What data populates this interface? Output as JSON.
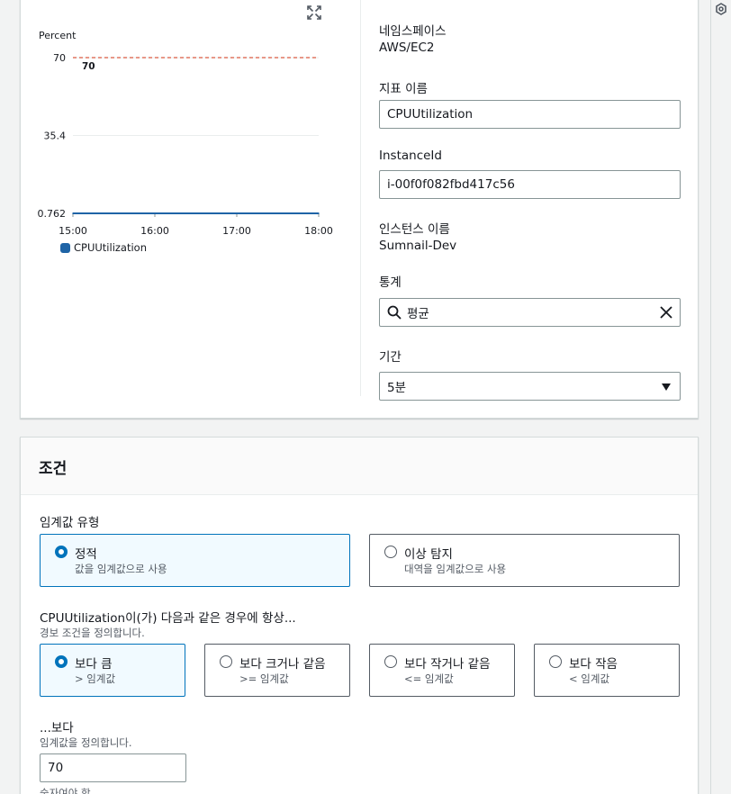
{
  "chart_data": {
    "type": "line",
    "ylabel": "Percent",
    "yticks": [
      "70",
      "35.4",
      "0.762"
    ],
    "ylim": [
      0.762,
      70
    ],
    "x": [
      "15:00",
      "16:00",
      "17:00",
      "18:00"
    ],
    "series": [
      {
        "name": "CPUUtilization",
        "color": "#1f64a6",
        "values": [
          0.762,
          0.762,
          0.762,
          0.762
        ]
      }
    ],
    "threshold": {
      "value": 70,
      "label": "70",
      "color": "#d13212"
    },
    "grid": true,
    "legend": "bottom-left"
  },
  "details": {
    "namespace_label": "네임스페이스",
    "namespace_value": "AWS/EC2",
    "metric_label": "지표 이름",
    "metric_value": "CPUUtilization",
    "instance_id_label": "InstanceId",
    "instance_id_value": "i-00f0f082fbd417c56",
    "instance_name_label": "인스턴스 이름",
    "instance_name_value": "Sumnail-Dev",
    "statistic_label": "통계",
    "statistic_value": "평균",
    "period_label": "기간",
    "period_value": "5분"
  },
  "conditions": {
    "title": "조건",
    "threshold_type_label": "임계값 유형",
    "threshold_types": [
      {
        "title": "정적",
        "sub": "값을 임계값으로 사용"
      },
      {
        "title": "이상 탐지",
        "sub": "대역을 임계값으로 사용"
      }
    ],
    "whenever_label": "CPUUtilization이(가) 다음과 같은 경우에 항상...",
    "whenever_desc": "경보 조건을 정의합니다.",
    "operators": [
      {
        "title": "보다 큼",
        "sub": "> 임계값"
      },
      {
        "title": "보다 크거나 같음",
        "sub": ">= 임계값"
      },
      {
        "title": "보다 작거나 같음",
        "sub": "<= 임계값"
      },
      {
        "title": "보다 작음",
        "sub": "< 임계값"
      }
    ],
    "than_label": "...보다",
    "than_desc": "임계값을 정의합니다.",
    "threshold_value": "70",
    "number_hint": "숫자여야 함"
  },
  "colors": {
    "accent": "#0073bb",
    "threshold": "#d13212",
    "series": "#1f64a6"
  }
}
